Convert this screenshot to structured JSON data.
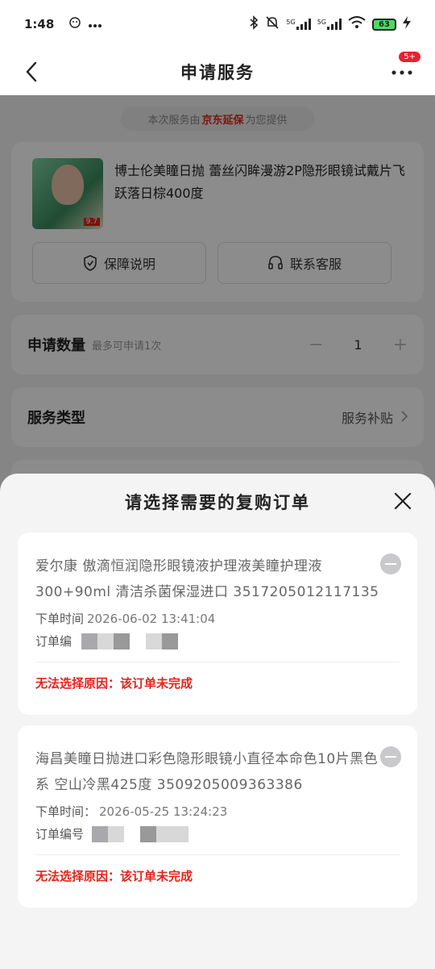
{
  "status_bar": {
    "time": "1:48",
    "battery": "63",
    "icons": [
      "app-notification-icon",
      "more-dots-icon",
      "bluetooth-icon",
      "mute-icon",
      "signal-5g-icon",
      "signal-5g-icon",
      "wifi-icon",
      "battery-icon",
      "charging-icon"
    ],
    "network_label_1": "5G",
    "network_label_2": "5G"
  },
  "header": {
    "title": "申请服务",
    "badge": "5+"
  },
  "provider": {
    "prefix": "本次服务由",
    "brand": "京东延保",
    "suffix": "为您提供"
  },
  "product": {
    "name": "博士伦美瞳日抛 蕾丝闪眸漫游2P隐形眼镜试戴片飞跃落日棕400度",
    "thumb_tag": "9.7",
    "guarantee_btn": "保障说明",
    "service_btn": "联系客服"
  },
  "quantity": {
    "label": "申请数量",
    "hint": "最多可申请1次",
    "value": "1",
    "minus": "−",
    "plus": "+"
  },
  "service_type": {
    "label": "服务类型",
    "value": "服务补贴"
  },
  "sheet": {
    "title": "请选择需要的复购订单",
    "orders": [
      {
        "name": "爱尔康 傲滴恒润隐形眼镜液护理液美瞳护理液300+90ml 清洁杀菌保湿进口 3517205012117135",
        "time_label": "下单时间",
        "time_value": "2026-06-02 13:41:04",
        "number_label": "订单编",
        "reason": "无法选择原因：该订单未完成"
      },
      {
        "name": "海昌美瞳日抛进口彩色隐形眼镜小直径本命色10片黑色系 空山冷黑425度 3509205009363386",
        "time_label": "下单时间：",
        "time_value": "2026-05-25 13:24:23",
        "number_label": "订单编号",
        "reason": "无法选择原因：该订单未完成"
      }
    ]
  },
  "colors": {
    "accent_red": "#e1251b",
    "brand_red": "#e2231a"
  }
}
